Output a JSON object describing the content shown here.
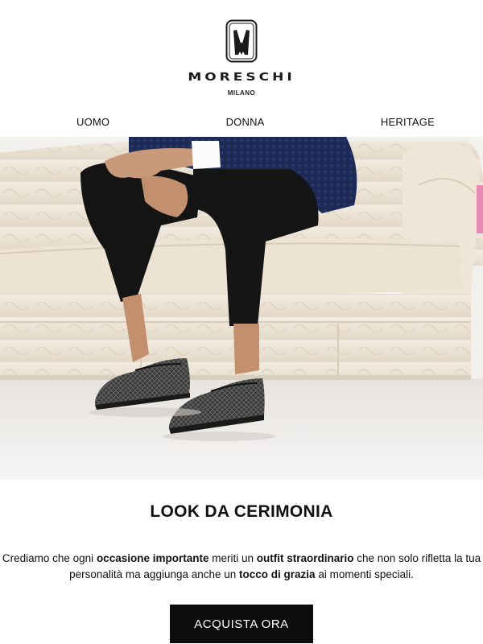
{
  "header": {
    "logo_icon": "moreschi-crest-icon",
    "brand_name": "MORESCHI",
    "brand_sub": "MILANO"
  },
  "nav": {
    "items": [
      {
        "label": "UOMO"
      },
      {
        "label": "DONNA"
      },
      {
        "label": "HERITAGE"
      }
    ]
  },
  "hero": {
    "image": "man-seated-on-cream-sofa-wearing-patterned-loafers"
  },
  "main": {
    "title": "LOOK DA CERIMONIA",
    "body": {
      "t1": "Crediamo che ogni ",
      "b1": "occasione importante",
      "t2": " meriti un ",
      "b2": "outfit straordinario",
      "t3": " che non solo rifletta la tua personalità ma aggiunga anche un ",
      "b3": "tocco di grazia",
      "t4": " ai momenti speciali."
    },
    "cta_label": "ACQUISTA ORA"
  },
  "colors": {
    "accent": "#0c0c0c",
    "background": "#ffffff",
    "sofa": "#efe7da"
  }
}
